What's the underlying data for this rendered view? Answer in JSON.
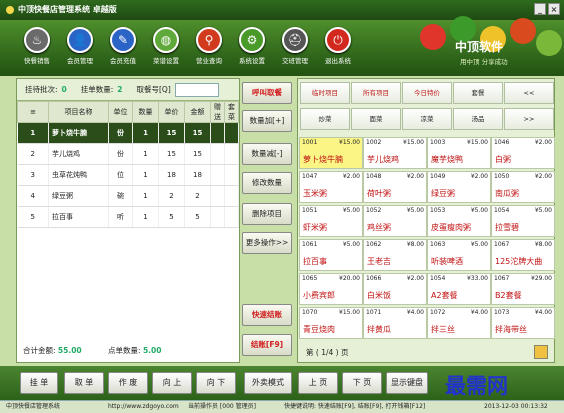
{
  "window": {
    "title": "中顶快餐店管理系统 卓越版",
    "min": "_",
    "close": "×"
  },
  "toolbar": [
    {
      "label": "快餐销售",
      "icon": "♨",
      "color": "#6a6a6a"
    },
    {
      "label": "会员管理",
      "icon": "👤",
      "color": "#2a64c6"
    },
    {
      "label": "会员充值",
      "icon": "✎",
      "color": "#2a64c6"
    },
    {
      "label": "菜谱设置",
      "icon": "◍",
      "color": "#5fa83a"
    },
    {
      "label": "营业查询",
      "icon": "⚲",
      "color": "#d23a1e"
    },
    {
      "label": "系统设置",
      "icon": "⚙",
      "color": "#4a9a2a"
    },
    {
      "label": "交班管理",
      "icon": "⛑",
      "color": "#555"
    },
    {
      "label": "退出系统",
      "icon": "⏻",
      "color": "#d2281e"
    }
  ],
  "brand": {
    "name": "中顶软件",
    "slogan": "用中顶 分享成功"
  },
  "order": {
    "batch_label": "挂待批次:",
    "batch": "0",
    "hang_label": "挂单数量:",
    "hang": "2",
    "take_label": "取餐号[Q]",
    "take_value": ""
  },
  "columns": [
    "项目名称",
    "单位",
    "数量",
    "单价",
    "金额",
    "赠送",
    "套菜"
  ],
  "items": [
    {
      "idx": "1",
      "name": "萝卜烧牛腩",
      "unit": "份",
      "qty": "1",
      "price": "15",
      "amount": "15"
    },
    {
      "idx": "2",
      "name": "芋儿烧鸡",
      "unit": "份",
      "qty": "1",
      "price": "15",
      "amount": "15"
    },
    {
      "idx": "3",
      "name": "虫草花炖鸭",
      "unit": "位",
      "qty": "1",
      "price": "18",
      "amount": "18"
    },
    {
      "idx": "4",
      "name": "绿豆粥",
      "unit": "碗",
      "qty": "1",
      "price": "2",
      "amount": "2"
    },
    {
      "idx": "5",
      "name": "拉百事",
      "unit": "听",
      "qty": "1",
      "price": "5",
      "amount": "5"
    }
  ],
  "totals": {
    "amount_label": "合计金额:",
    "amount": "55.00",
    "count_label": "点单数量:",
    "count": "5.00"
  },
  "actions": [
    "呼叫取餐",
    "数量加[+]",
    "数量减[-]",
    "修改数量",
    "删除项目",
    "更多操作>>",
    "快速结账",
    "结账[F9]"
  ],
  "categories": [
    "临时项目",
    "所有项目",
    "今日特价",
    "套餐",
    "<<",
    "炒菜",
    "面菜",
    "凉菜",
    "汤品",
    ">>"
  ],
  "dishes": [
    {
      "code": "1001",
      "price": "¥15.00",
      "name": "萝卜烧牛腩"
    },
    {
      "code": "1002",
      "price": "¥15.00",
      "name": "芋儿烧鸡"
    },
    {
      "code": "1003",
      "price": "¥15.00",
      "name": "魔芋烧鸭"
    },
    {
      "code": "1046",
      "price": "¥2.00",
      "name": "白粥"
    },
    {
      "code": "1047",
      "price": "¥2.00",
      "name": "玉米粥"
    },
    {
      "code": "1048",
      "price": "¥2.00",
      "name": "荷叶粥"
    },
    {
      "code": "1049",
      "price": "¥2.00",
      "name": "绿豆粥"
    },
    {
      "code": "1050",
      "price": "¥2.00",
      "name": "南瓜粥"
    },
    {
      "code": "1051",
      "price": "¥5.00",
      "name": "虾米粥"
    },
    {
      "code": "1052",
      "price": "¥5.00",
      "name": "鸡丝粥"
    },
    {
      "code": "1053",
      "price": "¥5.00",
      "name": "皮蛋瘦肉粥"
    },
    {
      "code": "1054",
      "price": "¥5.00",
      "name": "拉雪碧"
    },
    {
      "code": "1061",
      "price": "¥5.00",
      "name": "拉百事"
    },
    {
      "code": "1062",
      "price": "¥8.00",
      "name": "王老吉"
    },
    {
      "code": "1063",
      "price": "¥5.00",
      "name": "听装啤酒"
    },
    {
      "code": "1067",
      "price": "¥8.00",
      "name": "125沱牌大曲"
    },
    {
      "code": "1065",
      "price": "¥20.00",
      "name": "小费宾郎"
    },
    {
      "code": "1066",
      "price": "¥2.00",
      "name": "白米饭"
    },
    {
      "code": "1054",
      "price": "¥33.00",
      "name": "A2套餐"
    },
    {
      "code": "1067",
      "price": "¥29.00",
      "name": "B2套餐"
    },
    {
      "code": "1070",
      "price": "¥15.00",
      "name": "青豆烧肉"
    },
    {
      "code": "1071",
      "price": "¥4.00",
      "name": "拌黄瓜"
    },
    {
      "code": "1072",
      "price": "¥4.00",
      "name": "拌三丝"
    },
    {
      "code": "1073",
      "price": "¥4.00",
      "name": "拌海带丝"
    }
  ],
  "pager": "第 ( 1/4 ) 页",
  "bottom_buttons": [
    "挂 单",
    "取 单",
    "作 废",
    "向 上",
    "向 下",
    "外卖模式",
    "上 页",
    "下 页",
    "显示键盘"
  ],
  "watermark": "最需网",
  "status": {
    "app": "中顶快餐店管理系统",
    "url": "http://www.zdgoyo.com",
    "operator": "当前操作员 [000 管理员]",
    "shortcut": "快捷键说明: 快速结账[F9], 结账[F9], 打开钱箱[F12]",
    "time": "2013-12-03 00:13:32"
  }
}
